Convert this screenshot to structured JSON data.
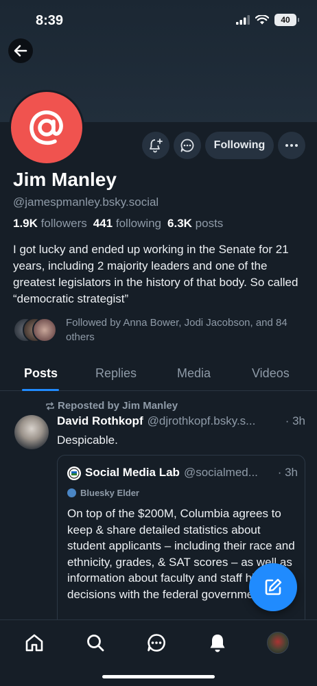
{
  "status": {
    "time": "8:39",
    "battery": "40"
  },
  "profile": {
    "display_name": "Jim Manley",
    "handle": "@jamespmanley.bsky.social",
    "avatar_icon": "at-sign-icon",
    "avatar_color": "#f0534f",
    "stats": {
      "followers_count": "1.9K",
      "followers_label": "followers",
      "following_count": "441",
      "following_label": "following",
      "posts_count": "6.3K",
      "posts_label": "posts"
    },
    "bio": "I got lucky and ended up working in the Senate for 21 years, including 2 majority leaders and one of the greatest legislators in the history of that body. So called “democratic strategist”",
    "followed_by": "Followed by Anna Bower, Jodi Jacobson, and 84 others"
  },
  "actions": {
    "following_label": "Following"
  },
  "tabs": [
    {
      "label": "Posts",
      "active": true
    },
    {
      "label": "Replies",
      "active": false
    },
    {
      "label": "Media",
      "active": false
    },
    {
      "label": "Videos",
      "active": false
    }
  ],
  "post": {
    "repost_label": "Reposted by Jim Manley",
    "author": "David Rothkopf",
    "handle": "@djrothkopf.bsky.s...",
    "time": "· 3h",
    "text": "Despicable.",
    "quote": {
      "author": "Social Media Lab",
      "handle": "@socialmed...",
      "time": "· 3h",
      "badge": "Bluesky Elder",
      "text": "On top of the $200M, Columbia agrees to keep & share detailed statistics about student applicants – including their race and ethnicity, grades, & SAT scores – as well as information about faculty and staff hiring decisions with the federal government."
    }
  },
  "colors": {
    "accent": "#208bfe",
    "background": "#161e27",
    "muted": "#8f9ba8"
  }
}
